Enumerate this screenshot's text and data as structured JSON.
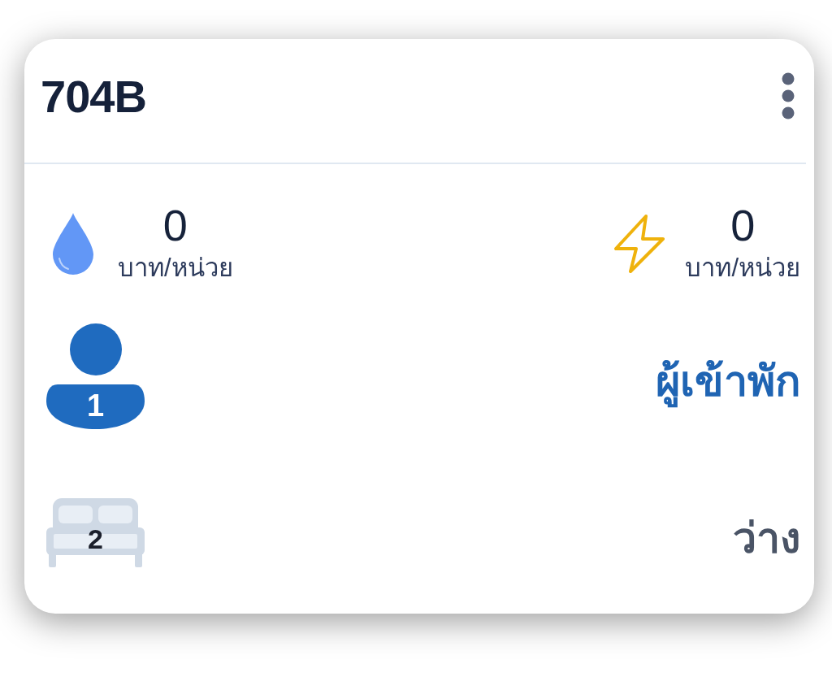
{
  "room": {
    "title": "704B"
  },
  "utilities": [
    {
      "kind": "water",
      "value": "0",
      "unit": "บาท/หน่วย"
    },
    {
      "kind": "electricity",
      "value": "0",
      "unit": "บาท/หน่วย"
    }
  ],
  "status_rows": [
    {
      "kind": "occupants",
      "count": "1",
      "label": "ผู้เข้าพัก"
    },
    {
      "kind": "beds",
      "count": "2",
      "label": "ว่าง"
    }
  ]
}
